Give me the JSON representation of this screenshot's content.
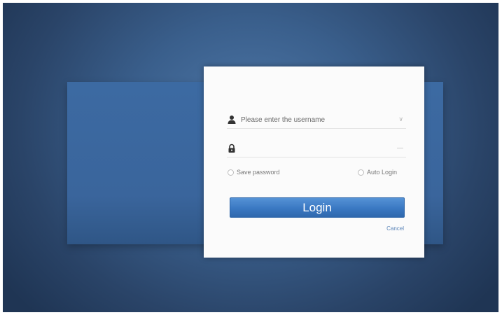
{
  "login_form": {
    "username": {
      "placeholder": "Please enter the username",
      "value": "",
      "icon": "user-icon",
      "tail": "∨"
    },
    "password": {
      "value": "",
      "icon": "lock-icon",
      "tail": "—"
    },
    "options": {
      "save_password_label": "Save password",
      "save_password_checked": false,
      "auto_login_label": "Auto Login",
      "auto_login_checked": false
    },
    "login_button_label": "Login",
    "cancel_label": "Cancel"
  },
  "colors": {
    "background": "#2a4468",
    "band": "#3a659c",
    "panel": "#fbfbfb",
    "button": "#3a78c2",
    "link": "#5a84b8"
  }
}
